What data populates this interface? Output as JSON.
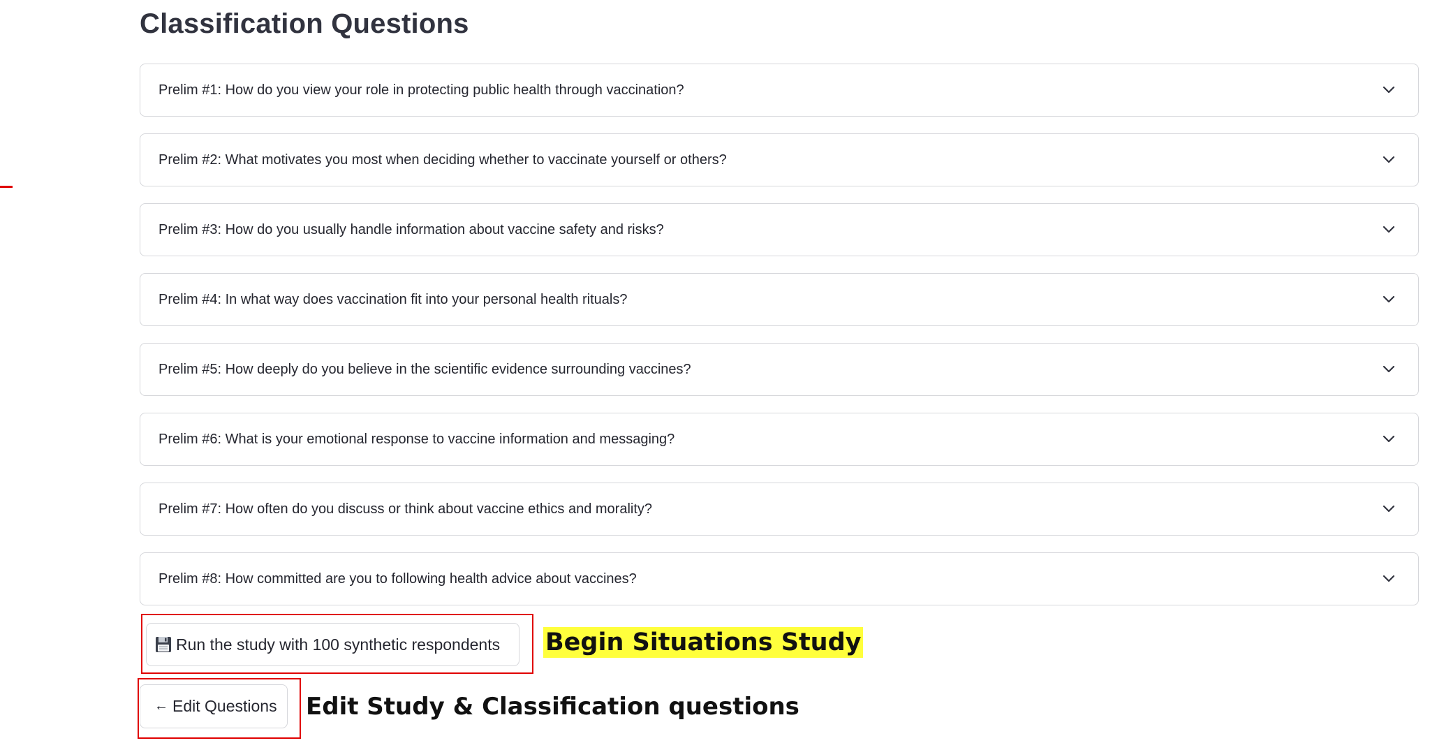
{
  "page": {
    "title": "Classification Questions"
  },
  "prelims": [
    {
      "label": "Prelim #1: How do you view your role in protecting public health through vaccination?"
    },
    {
      "label": "Prelim #2: What motivates you most when deciding whether to vaccinate yourself or others?"
    },
    {
      "label": "Prelim #3: How do you usually handle information about vaccine safety and risks?"
    },
    {
      "label": "Prelim #4: In what way does vaccination fit into your personal health rituals?"
    },
    {
      "label": "Prelim #5: How deeply do you believe in the scientific evidence surrounding vaccines?"
    },
    {
      "label": "Prelim #6: What is your emotional response to vaccine information and messaging?"
    },
    {
      "label": "Prelim #7: How often do you discuss or think about vaccine ethics and morality?"
    },
    {
      "label": "Prelim #8: How committed are you to following health advice about vaccines?"
    }
  ],
  "actions": {
    "run_label": "Run the study with 100 synthetic respondents",
    "run_icon": "floppy-disk-icon",
    "edit_label": "Edit Questions",
    "edit_icon": "arrow-left-icon",
    "edit_arrow_glyph": "←"
  },
  "annotations": {
    "begin_note": "Begin Situations Study",
    "edit_note": "Edit Study & Classification questions",
    "highlight_color": "#ffff3c",
    "box_color": "#e00000"
  }
}
